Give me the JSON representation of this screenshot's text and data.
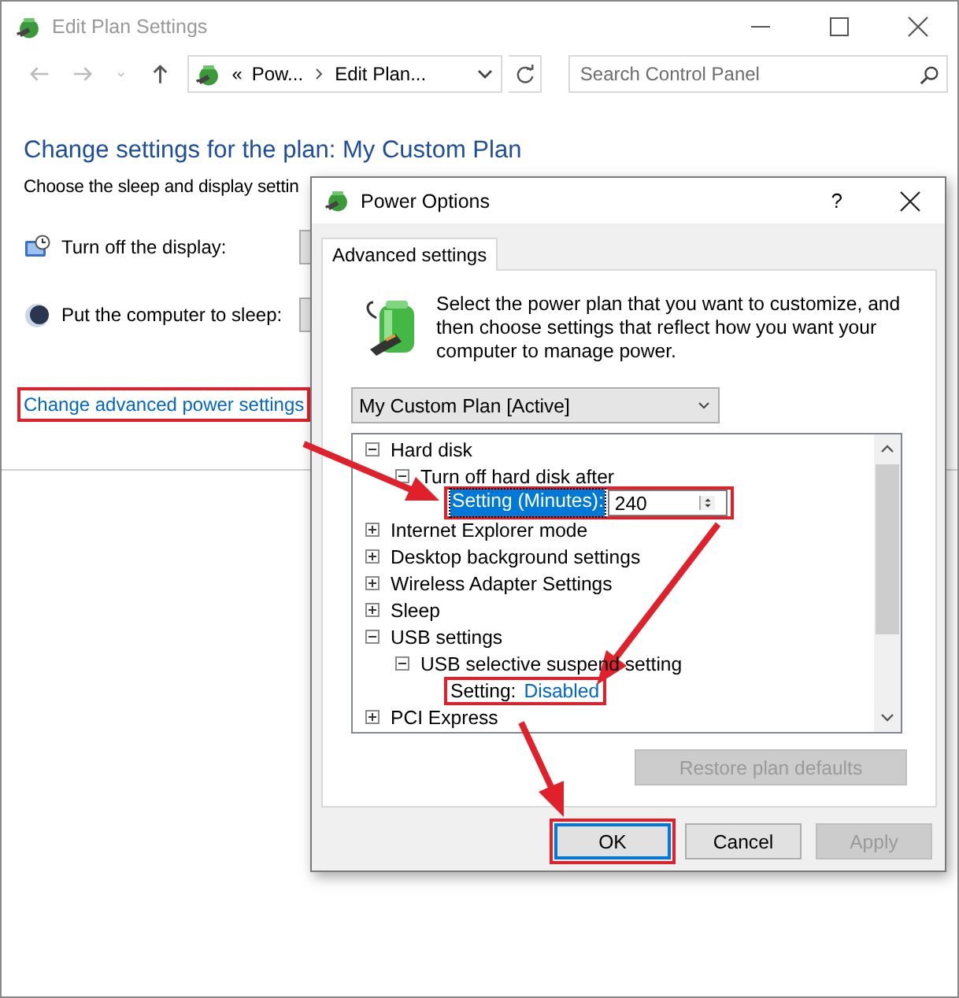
{
  "window": {
    "title": "Edit Plan Settings"
  },
  "address_bar": {
    "overflow": "«",
    "crumbs": [
      "Pow...",
      "Edit Plan..."
    ]
  },
  "search": {
    "placeholder": "Search Control Panel"
  },
  "heading": "Change settings for the plan: My Custom Plan",
  "description": "Choose the sleep and display settin",
  "settings": [
    {
      "kind": "display",
      "label": "Turn off the display:"
    },
    {
      "kind": "sleep",
      "label": "Put the computer to sleep:"
    }
  ],
  "advanced_link": {
    "label": "Change advanced power settings",
    "highlighted": true
  },
  "dialog": {
    "title": "Power Options",
    "help": "?",
    "tabs": [
      {
        "label": "Advanced settings",
        "selected": true
      }
    ],
    "intro": "Select the power plan that you want to customize, and then choose settings that reflect how you want your computer to manage power.",
    "plan_dropdown": {
      "value": "My Custom Plan [Active]"
    },
    "tree": [
      {
        "label": "Hard disk",
        "expanded": true,
        "children": [
          {
            "label": "Turn off hard disk after",
            "expanded": true,
            "children": [
              {
                "kind": "spin",
                "label": "Setting (Minutes):",
                "value": "240",
                "selected": true,
                "highlighted": true
              }
            ]
          }
        ]
      },
      {
        "label": "Internet Explorer mode",
        "expanded": false
      },
      {
        "label": "Desktop background settings",
        "expanded": false
      },
      {
        "label": "Wireless Adapter Settings",
        "expanded": false
      },
      {
        "label": "Sleep",
        "expanded": false
      },
      {
        "label": "USB settings",
        "expanded": true,
        "children": [
          {
            "label": "USB selective suspend setting",
            "expanded": true,
            "children": [
              {
                "kind": "value",
                "label": "Setting:",
                "value": "Disabled",
                "selected": false,
                "highlighted": true
              }
            ]
          }
        ]
      },
      {
        "label": "PCI Express",
        "expanded": false
      }
    ],
    "restore_button": {
      "label": "Restore plan defaults",
      "disabled": true
    },
    "buttons": [
      {
        "label": "OK",
        "disabled": false,
        "focused": true,
        "highlighted": true
      },
      {
        "label": "Cancel",
        "disabled": false,
        "focused": false,
        "highlighted": false
      },
      {
        "label": "Apply",
        "disabled": true,
        "focused": false,
        "highlighted": false
      }
    ]
  }
}
